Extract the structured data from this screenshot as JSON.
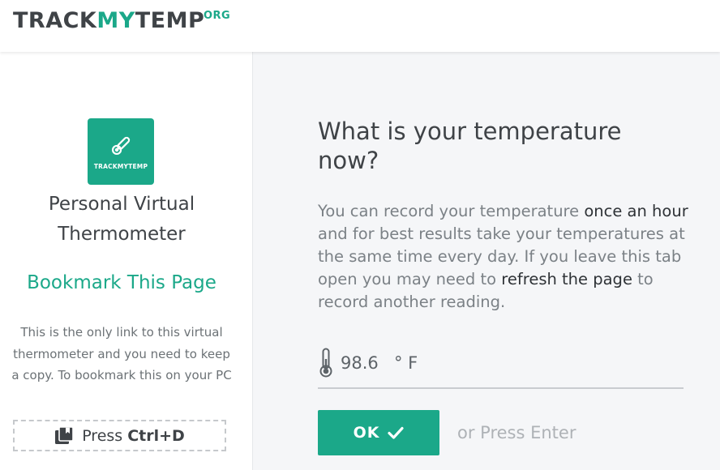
{
  "header": {
    "logo_track": "TRACK",
    "logo_my": "MY",
    "logo_temp": "TEMP",
    "logo_org": "ORG"
  },
  "sidebar": {
    "app_icon_label": "TRACKMYTEMP",
    "subtitle": "Personal Virtual Thermometer",
    "bookmark_heading": "Bookmark This Page",
    "bookmark_note": "This is the only link to this virtual thermometer and you need to keep a copy. To bookmark this on your PC",
    "press_label": "Press",
    "press_keys": "Ctrl+D"
  },
  "main": {
    "question": "What is your temperature now?",
    "desc_1": "You can record your temperature ",
    "desc_2": "once an hour",
    "desc_3": " and for best results take your temperatures at the same time every day. If you leave this tab open you may need to ",
    "desc_4": "refresh the page",
    "desc_5": " to record another reading.",
    "temperature_value": "98.6",
    "temperature_unit": "° F",
    "ok_label": "OK",
    "enter_hint": "or Press Enter"
  },
  "colors": {
    "accent": "#1ba889",
    "text_dark": "#3f4347",
    "panel_bg": "#f5f6f8"
  },
  "icons": {
    "app": "thermometer-icon",
    "bookmark": "bookmark-icon",
    "input": "thermometer-icon",
    "ok": "checkmark-icon"
  }
}
